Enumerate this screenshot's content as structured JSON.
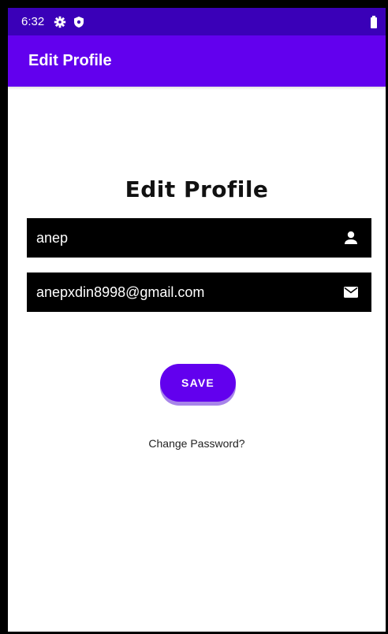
{
  "status_bar": {
    "time": "6:32",
    "icons": [
      "gear-icon",
      "shield-icon",
      "battery-icon"
    ]
  },
  "app_bar": {
    "title": "Edit Profile",
    "color": "#6200ee"
  },
  "main": {
    "heading": "Edit Profile",
    "name_field": {
      "value": "anep",
      "icon": "person-icon"
    },
    "email_field": {
      "value": "anepxdin8998@gmail.com",
      "icon": "mail-icon"
    },
    "save_label": "SAVE",
    "change_password_label": "Change Password?"
  },
  "colors": {
    "status_bar": "#3a00b8",
    "accent": "#6200ee",
    "field_background": "#000000"
  }
}
